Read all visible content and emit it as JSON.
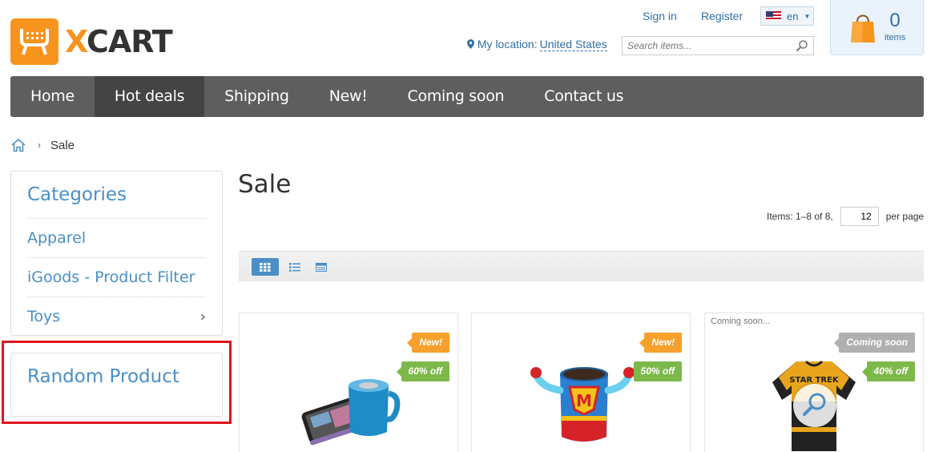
{
  "brand": {
    "logo_text_x": "X",
    "logo_text_rest": "CART",
    "accent": "#f7941d"
  },
  "header": {
    "sign_in": "Sign in",
    "register": "Register",
    "language": "en",
    "location_label": "My location:",
    "location_value": "United States",
    "search_placeholder": "Search items...",
    "cart_count": "0",
    "cart_label": "items"
  },
  "nav": {
    "items": [
      "Home",
      "Hot deals",
      "Shipping",
      "New!",
      "Coming soon",
      "Contact us"
    ],
    "active": "Hot deals"
  },
  "breadcrumb": {
    "current": "Sale"
  },
  "sidebar": {
    "categories_title": "Categories",
    "categories": [
      "Apparel",
      "iGoods - Product Filter",
      "Toys"
    ],
    "random_product_title": "Random Product"
  },
  "main": {
    "title": "Sale",
    "items_info": "Items: 1–8 of 8,",
    "per_page_value": "12",
    "per_page_label": "per page",
    "view_modes": [
      "grid-view-icon",
      "list-view-icon",
      "table-view-icon"
    ]
  },
  "products": [
    {
      "coming_note": "",
      "badge_top": "New!",
      "discount": "60% off",
      "image": "speaker-phone"
    },
    {
      "coming_note": "",
      "badge_top": "New!",
      "discount": "50% off",
      "image": "superhero-mug"
    },
    {
      "coming_note": "Coming soon...",
      "badge_top": "Coming soon",
      "discount": "40% off",
      "image": "star-trek-jersey"
    }
  ]
}
